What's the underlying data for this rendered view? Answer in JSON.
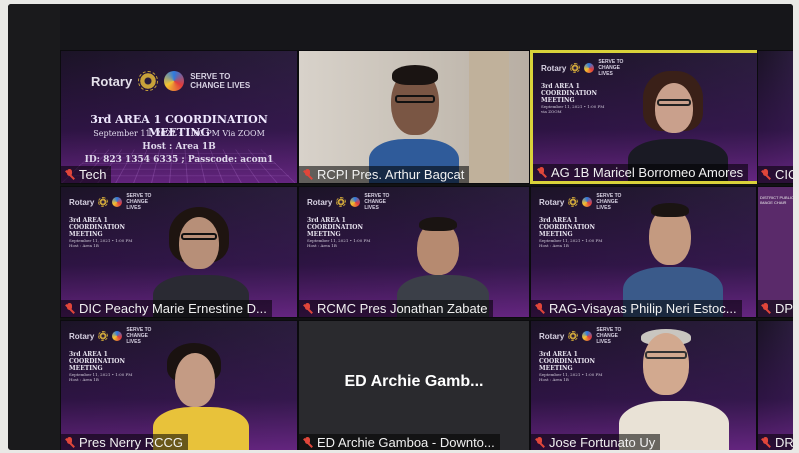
{
  "slide": {
    "brand": "Rotary",
    "tagline": "SERVE TO CHANGE LIVES",
    "title": "3rd AREA 1 COORDINATION MEETING",
    "date_line": "September 11, 2021 • 1:00 PM Via ZOOM",
    "host_line": "Host : Area 1B",
    "id_line": "ID: 823 1354 6335 ; Passcode: acom1",
    "name": "Tech"
  },
  "mini_slide": {
    "brand": "Rotary",
    "tagline": "SERVE TO CHANGE LIVES",
    "title": "3rd AREA 1 COORDINATION MEETING",
    "date_line": "September 11, 2021 • 1:00 PM",
    "via": "via ZOOM",
    "host_line": "Host : Area 1B"
  },
  "participants": [
    {
      "name": "RCPI Pres. Arthur Bagcat"
    },
    {
      "name": "AG 1B Maricel Borromeo Amores"
    },
    {
      "name": "CIC"
    },
    {
      "name": "DIC Peachy Marie Ernestine D..."
    },
    {
      "name": "RCMC Pres Jonathan Zabate"
    },
    {
      "name": "RAG-Visayas Philip Neri Estoc..."
    },
    {
      "name": "DP"
    },
    {
      "name": "Pres Nerry RCCG"
    },
    {
      "name": "ED Archie Gamboa - Downto...",
      "display_name": "ED Archie Gamb..."
    },
    {
      "name": "Jose Fortunato Uy"
    },
    {
      "name": "DR"
    }
  ],
  "side_text": "DISTRICT PUBLIC IMAGE CHAIR",
  "colors": {
    "active_speaker_border": "#d9d23a",
    "muted_mic": "#e0463a",
    "slide_purple": "#7a2f9a"
  }
}
